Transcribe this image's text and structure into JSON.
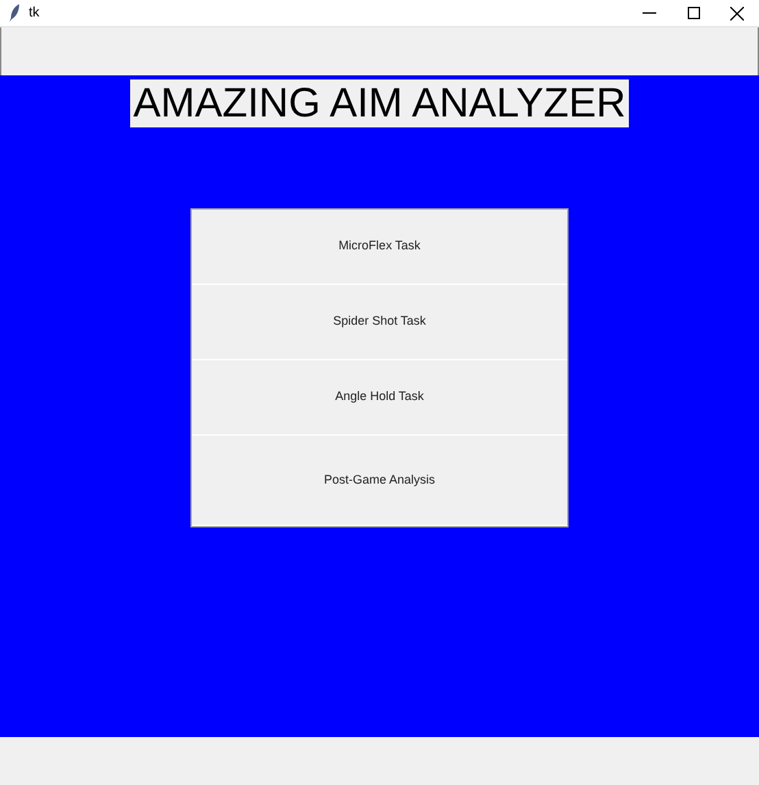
{
  "window": {
    "title": "tk"
  },
  "heading": "AMAZING AIM ANALYZER",
  "buttons": [
    {
      "label": "MicroFlex Task"
    },
    {
      "label": "Spider Shot Task"
    },
    {
      "label": "Angle Hold Task"
    },
    {
      "label": "Post-Game Analysis"
    }
  ]
}
